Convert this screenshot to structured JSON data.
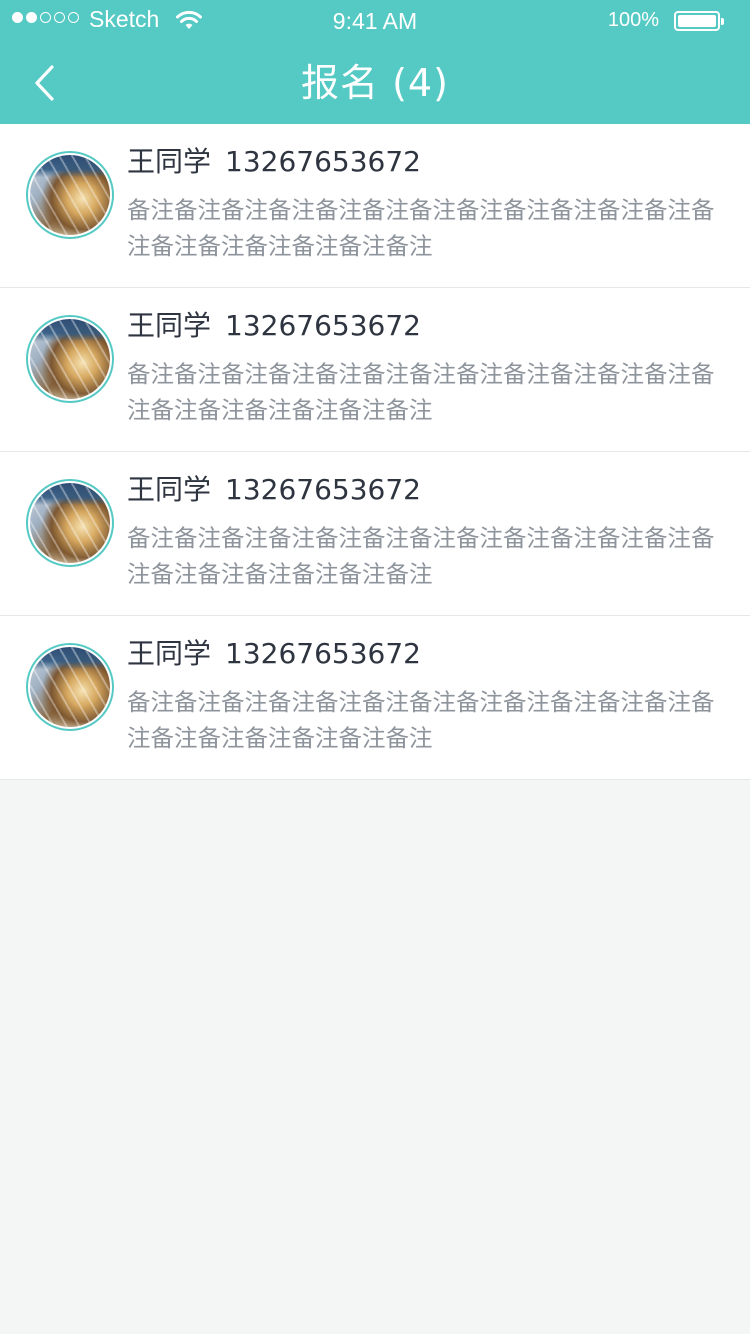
{
  "status_bar": {
    "carrier": "Sketch",
    "time": "9:41 AM",
    "battery": "100%"
  },
  "nav": {
    "title": "报名 (4)"
  },
  "entries": [
    {
      "name": "王同学",
      "phone": "13267653672",
      "remark": "备注备注备注备注备注备注备注备注备注备注备注备注备注备注备注备注备注备注备注"
    },
    {
      "name": "王同学",
      "phone": "13267653672",
      "remark": "备注备注备注备注备注备注备注备注备注备注备注备注备注备注备注备注备注备注备注"
    },
    {
      "name": "王同学",
      "phone": "13267653672",
      "remark": "备注备注备注备注备注备注备注备注备注备注备注备注备注备注备注备注备注备注备注"
    },
    {
      "name": "王同学",
      "phone": "13267653672",
      "remark": "备注备注备注备注备注备注备注备注备注备注备注备注备注备注备注备注备注备注备注"
    }
  ],
  "colors": {
    "accent": "#55c9c3",
    "background": "#f4f5f5",
    "name_text": "#2f3540",
    "remark_text": "#8e949c"
  }
}
